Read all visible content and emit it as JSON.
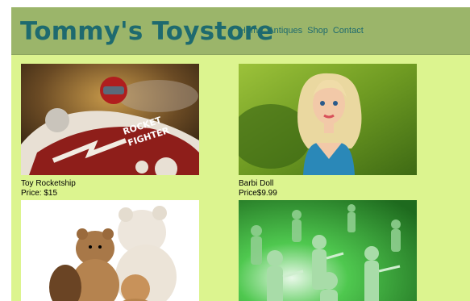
{
  "header": {
    "brand": "Tommy's Toystore",
    "nav": [
      {
        "label": "Home"
      },
      {
        "label": "Antiques"
      },
      {
        "label": "Shop"
      },
      {
        "label": "Contact"
      }
    ]
  },
  "products": [
    {
      "name": "Toy Rocketship",
      "price": "Price: $15",
      "image_text": [
        "ROCKET",
        "FIGHTER"
      ]
    },
    {
      "name": "Barbi Doll",
      "price": "Price$9.99"
    },
    {
      "name": "",
      "price": ""
    },
    {
      "name": "",
      "price": ""
    }
  ],
  "colors": {
    "page_bg": "#dcf48f",
    "header_bg": "#9bb56a",
    "brand": "#1e6a6f"
  }
}
